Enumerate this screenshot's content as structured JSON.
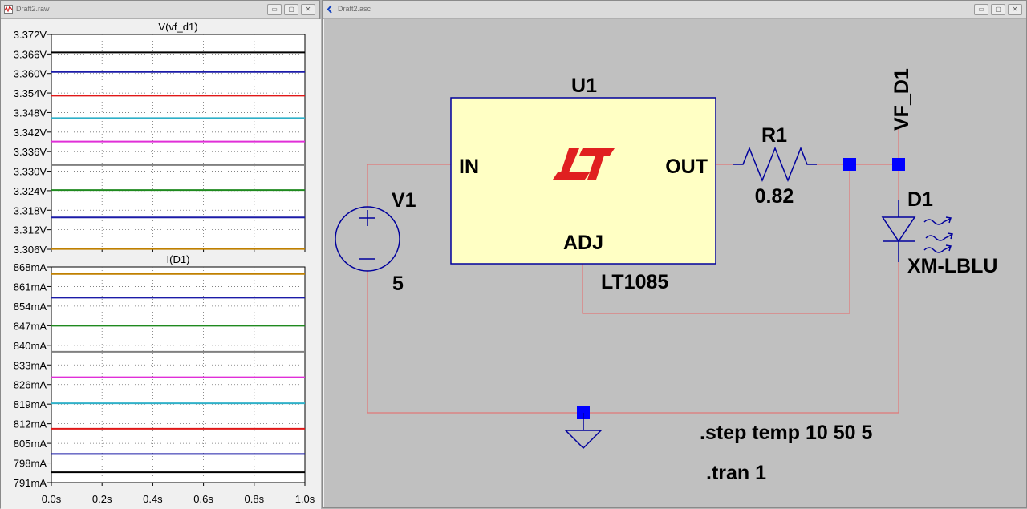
{
  "waveform_window": {
    "title": "Draft2.raw",
    "buttons": [
      "▭",
      "▢",
      "✕"
    ],
    "panes": [
      {
        "trace_label": "V(vf_d1)",
        "y_ticks": [
          "3.372V",
          "3.366V",
          "3.360V",
          "3.354V",
          "3.348V",
          "3.342V",
          "3.336V",
          "3.330V",
          "3.324V",
          "3.318V",
          "3.312V",
          "3.306V"
        ]
      },
      {
        "trace_label": "I(D1)",
        "y_ticks": [
          "868mA",
          "861mA",
          "854mA",
          "847mA",
          "840mA",
          "833mA",
          "826mA",
          "819mA",
          "812mA",
          "805mA",
          "798mA",
          "791mA"
        ]
      }
    ],
    "x_ticks": [
      "0.0s",
      "0.2s",
      "0.4s",
      "0.6s",
      "0.8s",
      "1.0s"
    ]
  },
  "chart_data": [
    {
      "type": "line",
      "title": "V(vf_d1)",
      "xlabel": "",
      "ylabel": "",
      "xlim": [
        0,
        1.0
      ],
      "ylim": [
        3.306,
        3.372
      ],
      "grid": true,
      "series": [
        {
          "color": "#000000",
          "values": [
            3.3665,
            3.3665
          ]
        },
        {
          "color": "#1c1ca8",
          "values": [
            3.3605,
            3.3605
          ]
        },
        {
          "color": "#e01818",
          "values": [
            3.3532,
            3.3532
          ]
        },
        {
          "color": "#2fb0c8",
          "values": [
            3.3463,
            3.3463
          ]
        },
        {
          "color": "#e02fd8",
          "values": [
            3.3391,
            3.3391
          ]
        },
        {
          "color": "#808080",
          "values": [
            3.3319,
            3.3319
          ]
        },
        {
          "color": "#1f8a1f",
          "values": [
            3.3242,
            3.3242
          ]
        },
        {
          "color": "#1c1ca8",
          "values": [
            3.3158,
            3.3158
          ]
        },
        {
          "color": "#c08000",
          "values": [
            3.3061,
            3.3061
          ]
        }
      ],
      "x": [
        0,
        1.0
      ]
    },
    {
      "type": "line",
      "title": "I(D1)",
      "xlabel": "",
      "ylabel": "",
      "xlim": [
        0,
        1.0
      ],
      "ylim": [
        791,
        868
      ],
      "grid": true,
      "series": [
        {
          "color": "#c08000",
          "values": [
            865.5,
            865.5
          ]
        },
        {
          "color": "#1c1ca8",
          "values": [
            857.0,
            857.0
          ]
        },
        {
          "color": "#1f8a1f",
          "values": [
            847.0,
            847.0
          ]
        },
        {
          "color": "#808080",
          "values": [
            837.7,
            837.7
          ]
        },
        {
          "color": "#e02fd8",
          "values": [
            828.6,
            828.6
          ]
        },
        {
          "color": "#2fb0c8",
          "values": [
            819.3,
            819.3
          ]
        },
        {
          "color": "#e01818",
          "values": [
            810.2,
            810.2
          ]
        },
        {
          "color": "#1c1ca8",
          "values": [
            801.2,
            801.2
          ]
        },
        {
          "color": "#000000",
          "values": [
            794.7,
            794.7
          ]
        }
      ],
      "x": [
        0,
        1.0
      ]
    }
  ],
  "schematic_window": {
    "title": "Draft2.asc",
    "buttons": [
      "▭",
      "▢",
      "✕"
    ],
    "labels": {
      "u1": "U1",
      "in": "IN",
      "out": "OUT",
      "adj": "ADJ",
      "part": "LT1085",
      "v1": "V1",
      "v1_value": "5",
      "r1": "R1",
      "r1_value": "0.82",
      "d1": "D1",
      "d1_model": "XM-LBLU",
      "net": "VF_D1",
      "step_directive": ".step temp 10 50 5",
      "tran_directive": ".tran 1"
    },
    "colors": {
      "wire": "#e07878",
      "component": "#00009c",
      "ic_fill": "#ffffc4",
      "junction": "#0000ff",
      "logo": "#e02020",
      "background": "#c0c0c0"
    }
  }
}
